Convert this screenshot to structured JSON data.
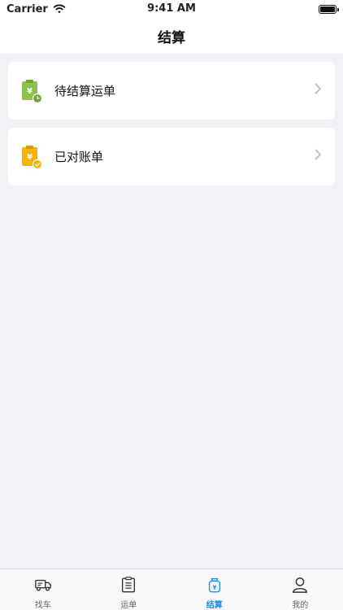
{
  "status_bar": {
    "carrier": "Carrier",
    "time": "9:41 AM"
  },
  "header": {
    "title": "结算"
  },
  "main": {
    "items": [
      {
        "label": "待结算运单",
        "icon": "pending-bill-icon",
        "accent": "#8bc34a"
      },
      {
        "label": "已对账单",
        "icon": "reconciled-bill-icon",
        "accent": "#f5b400"
      }
    ]
  },
  "tab_bar": {
    "tabs": [
      {
        "label": "找车",
        "icon": "truck-icon",
        "active": false
      },
      {
        "label": "运单",
        "icon": "clipboard-list-icon",
        "active": false
      },
      {
        "label": "结算",
        "icon": "yen-bag-icon",
        "active": true
      },
      {
        "label": "我的",
        "icon": "person-icon",
        "active": false
      }
    ],
    "active_color": "#1c8ff0"
  }
}
